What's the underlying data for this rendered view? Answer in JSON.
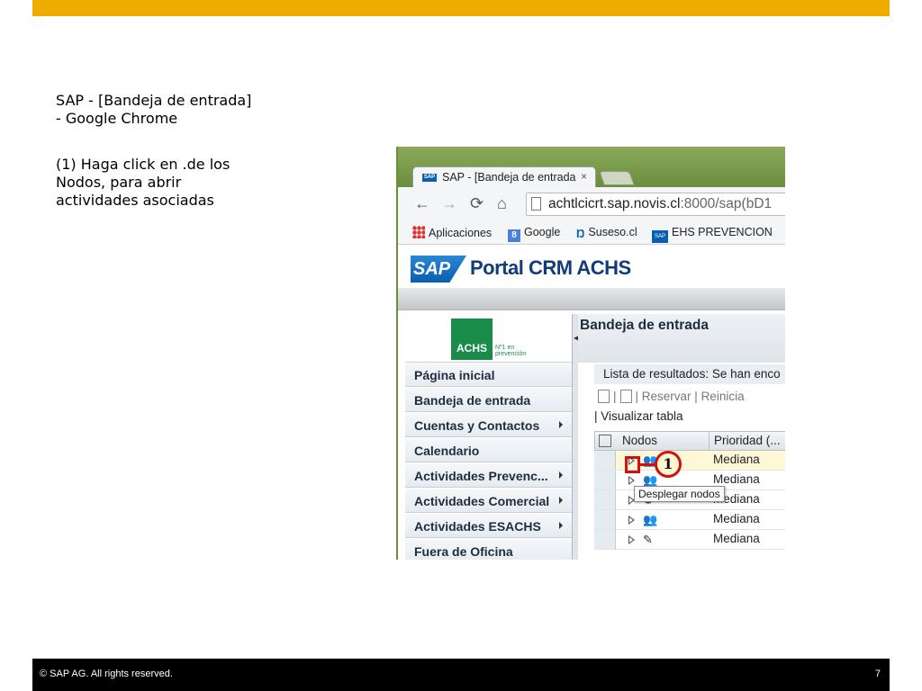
{
  "slide": {
    "title_line1": "SAP - [Bandeja de entrada]",
    "title_line2": "- Google Chrome",
    "instruction_line1": "(1) Haga click en .de los",
    "instruction_line2": "Nodos, para abrir",
    "instruction_line3": "actividades asociadas",
    "accent_color": "#F0AB00"
  },
  "footer": {
    "copyright": "©  SAP AG. All rights reserved.",
    "page_number": "7"
  },
  "browser": {
    "tab_title": "SAP - [Bandeja de entrada",
    "tab_close": "×",
    "url_host": "achtlcicrt.sap.novis.cl",
    "url_rest": ":8000/sap(bD1",
    "bookmarks": {
      "apps": "Aplicaciones",
      "google": "Google",
      "suseso": "Suseso.cl",
      "ehs": "EHS PREVENCION"
    }
  },
  "portal": {
    "logo_text": "SAP",
    "title": "Portal CRM ACHS",
    "achs_logo": "ACHS",
    "achs_tagline_1": "Nº1 en",
    "achs_tagline_2": "prevención",
    "menu": [
      {
        "label": "Página inicial",
        "has_submenu": false
      },
      {
        "label": "Bandeja de entrada",
        "has_submenu": false
      },
      {
        "label": "Cuentas y Contactos",
        "has_submenu": true
      },
      {
        "label": "Calendario",
        "has_submenu": false
      },
      {
        "label": "Actividades Prevenc...",
        "has_submenu": true
      },
      {
        "label": "Actividades Comercial",
        "has_submenu": true
      },
      {
        "label": "Actividades ESACHS",
        "has_submenu": true
      },
      {
        "label": "Fuera de Oficina",
        "has_submenu": false
      }
    ],
    "main_title": "Bandeja de entrada",
    "results_text": "Lista de resultados: Se han enco",
    "toolbar": {
      "reservar": "Reservar",
      "reiniciar": "Reinicia",
      "visualizar": "Visualizar tabla"
    },
    "grid": {
      "col_nodes": "Nodos",
      "col_priority": "Prioridad (...",
      "rows": [
        {
          "priority": "Mediana"
        },
        {
          "priority": "Mediana"
        },
        {
          "priority": "Mediana"
        },
        {
          "priority": "Mediana"
        },
        {
          "priority": "Mediana"
        }
      ]
    },
    "callout_number": "1",
    "tooltip": "Desplegar nodos"
  }
}
